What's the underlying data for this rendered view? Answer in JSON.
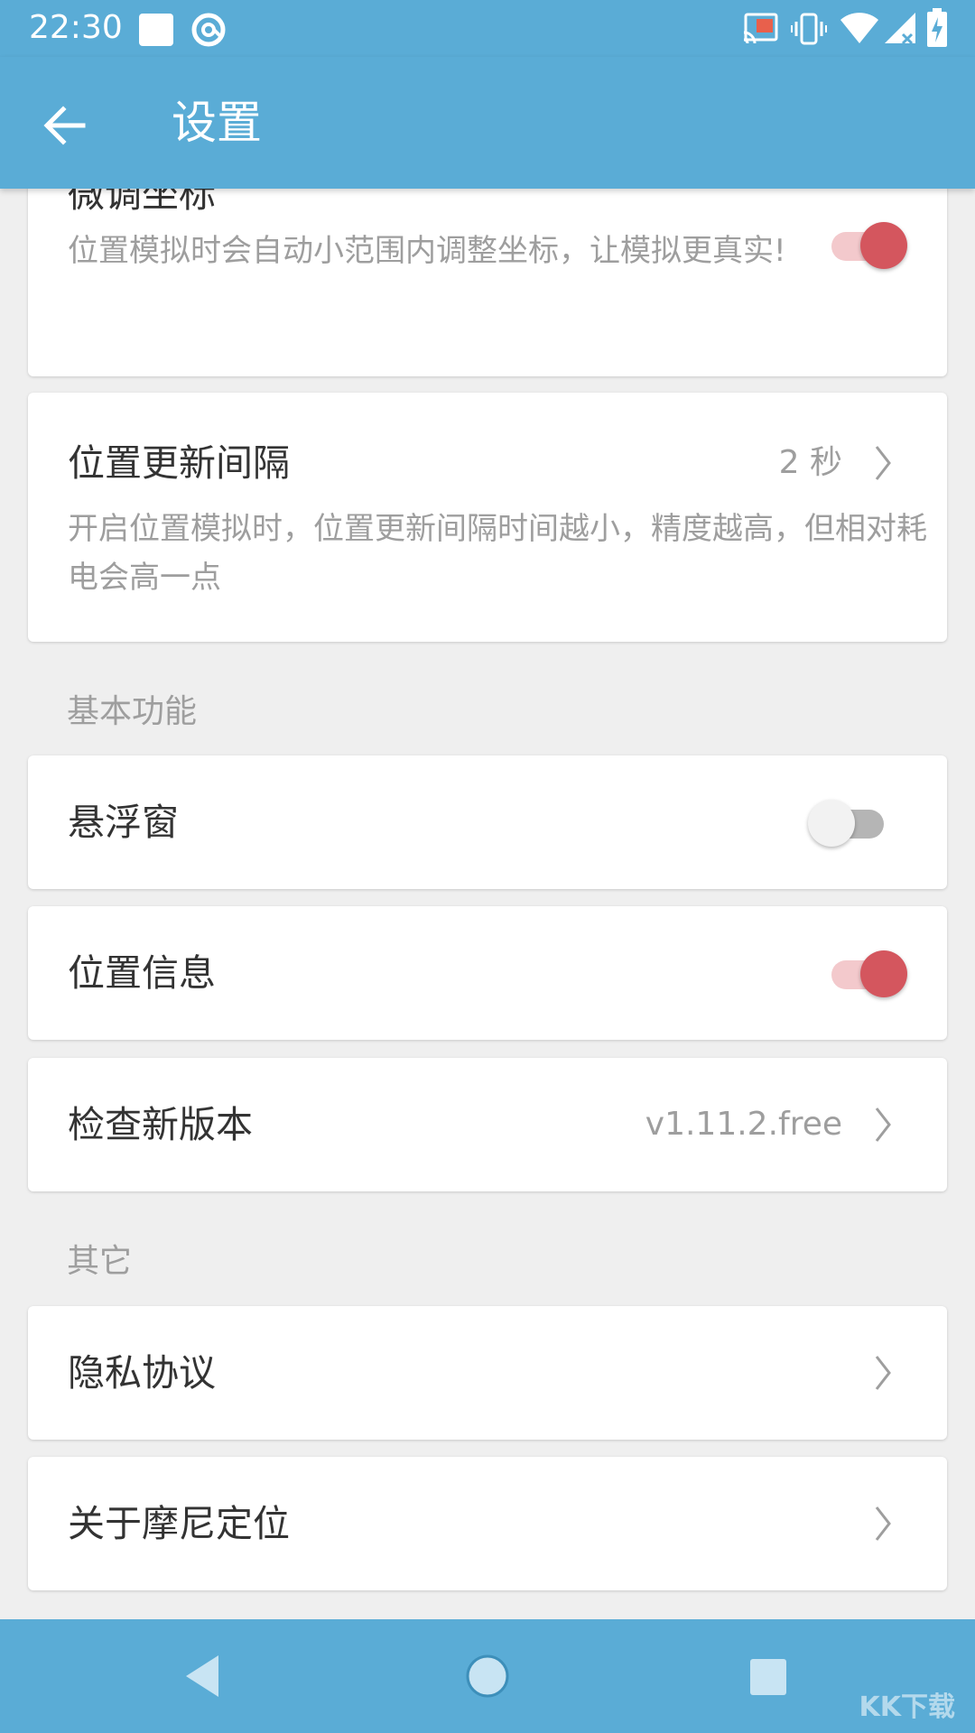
{
  "status_bar": {
    "time": "22:30"
  },
  "app_bar": {
    "title": "设置",
    "back_icon": "arrow-back-icon"
  },
  "items": {
    "fine_tune": {
      "title": "微调坐标",
      "description": "位置模拟时会自动小范围内调整坐标，让模拟更真实!",
      "switch_on": true
    },
    "update_interval": {
      "title": "位置更新间隔",
      "value": "2 秒",
      "description": "开启位置模拟时，位置更新间隔时间越小，精度越高，但相对耗电会高一点"
    },
    "floating_window": {
      "title": "悬浮窗",
      "switch_on": false
    },
    "location_info": {
      "title": "位置信息",
      "switch_on": true
    },
    "check_version": {
      "title": "检查新版本",
      "value": "v1.11.2.free"
    },
    "privacy": {
      "title": "隐私协议"
    },
    "about": {
      "title": "关于摩尼定位"
    }
  },
  "sections": {
    "basic": "基本功能",
    "other": "其它"
  },
  "watermark": "KK下载",
  "colors": {
    "primary": "#5aacd6",
    "accent": "#d4565e",
    "background": "#efefef"
  }
}
